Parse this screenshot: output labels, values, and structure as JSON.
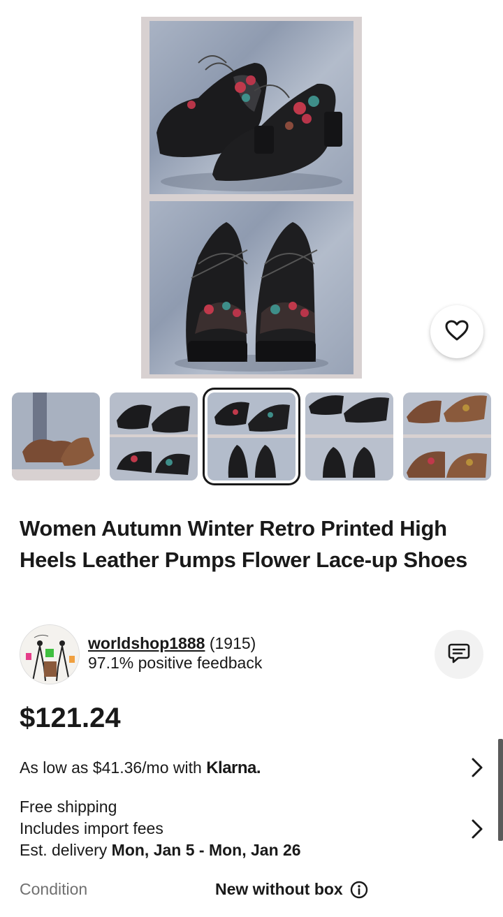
{
  "product": {
    "title": "Women Autumn Winter Retro Printed High Heels Leather Pumps Flower Lace-up Shoes",
    "price": "$121.24",
    "selected_image_index": 2,
    "image_count": 5
  },
  "seller": {
    "name": "worldshop1888",
    "feedback_count": "(1915)",
    "positive_feedback": "97.1% positive feedback"
  },
  "financing": {
    "text": "As low as $41.36/mo with",
    "brand": "Klarna."
  },
  "shipping": {
    "line1": "Free shipping",
    "line2": "Includes import fees",
    "delivery_label": "Est. delivery",
    "delivery_dates": "Mon, Jan 5 - Mon, Jan 26"
  },
  "condition": {
    "label": "Condition",
    "value": "New without box"
  },
  "icons": {
    "favorite": "heart-icon",
    "message": "message-icon",
    "chevron": "chevron-right-icon",
    "info": "info-icon"
  },
  "colors": {
    "text": "#191919",
    "muted": "#707070",
    "image_frame": "#d8d1d1"
  }
}
